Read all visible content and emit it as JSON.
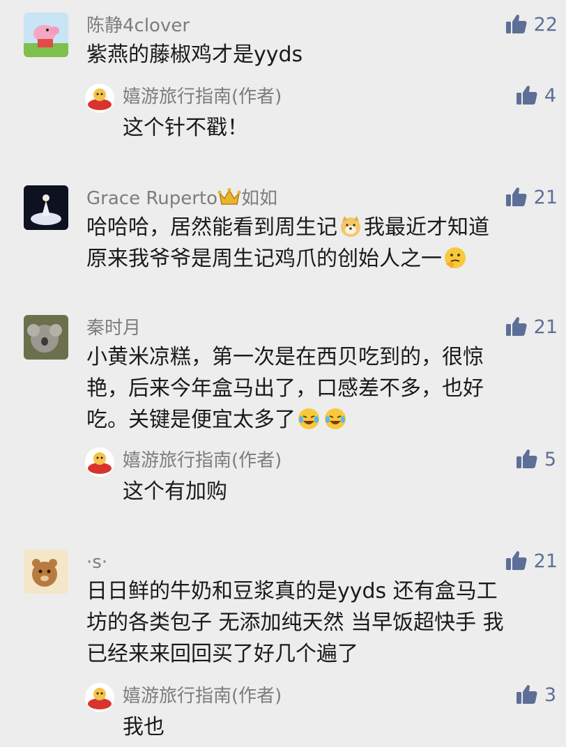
{
  "comments": [
    {
      "name": "陈静4clover",
      "likes": "22",
      "text": "紫燕的藤椒鸡才是yyds",
      "reply": {
        "name": "嬉游旅行指南(作者)",
        "likes": "4",
        "text": "这个针不戳！"
      }
    },
    {
      "name_prefix": "Grace Ruperto",
      "name_suffix": "如如",
      "likes": "21",
      "text_line1_a": "哈哈哈，居然能看到周生记",
      "text_line1_b": "我最近才知道",
      "text_line2": "原来我爷爷是周生记鸡爪的创始人之一"
    },
    {
      "name": "秦时月",
      "likes": "21",
      "text_line1": "小黄米凉糕，第一次是在西贝吃到的，很惊",
      "text_line2": "艳，后来今年盒马出了，口感差不多，也好",
      "text_line3": "吃。关键是便宜太多了",
      "reply": {
        "name": "嬉游旅行指南(作者)",
        "likes": "5",
        "text": "这个有加购"
      }
    },
    {
      "name": "·s·",
      "likes": "21",
      "text_line1": "日日鲜的牛奶和豆浆真的是yyds 还有盒马工",
      "text_line2": "坊的各类包子 无添加纯天然 当早饭超快手 我",
      "text_line3": "已经来来回回买了好几个遍了",
      "reply": {
        "name": "嬉游旅行指南(作者)",
        "likes": "3",
        "text": "我也"
      }
    }
  ],
  "colors": {
    "like": "#5d6f97",
    "name": "#7d7d7d",
    "background": "#ededed"
  },
  "icons": [
    "thumbs-up-icon",
    "crown-icon",
    "dog-emoji-icon",
    "thinking-emoji-icon",
    "laughing-crying-emoji-icon"
  ]
}
